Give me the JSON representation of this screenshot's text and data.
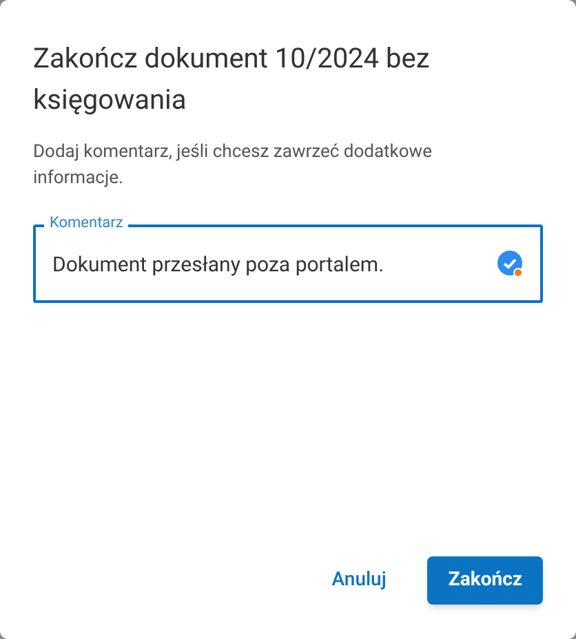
{
  "dialog": {
    "title": "Zakończ dokument 10/2024 bez księgowania",
    "description": "Dodaj komentarz, jeśli chcesz zawrzeć dodatkowe informacje.",
    "comment_field": {
      "label": "Komentarz",
      "value": "Dokument przesłany poza portalem."
    },
    "buttons": [
      {
        "label": "Anuluj",
        "kind": "text"
      },
      {
        "label": "Zakończ",
        "kind": "primary"
      }
    ]
  }
}
